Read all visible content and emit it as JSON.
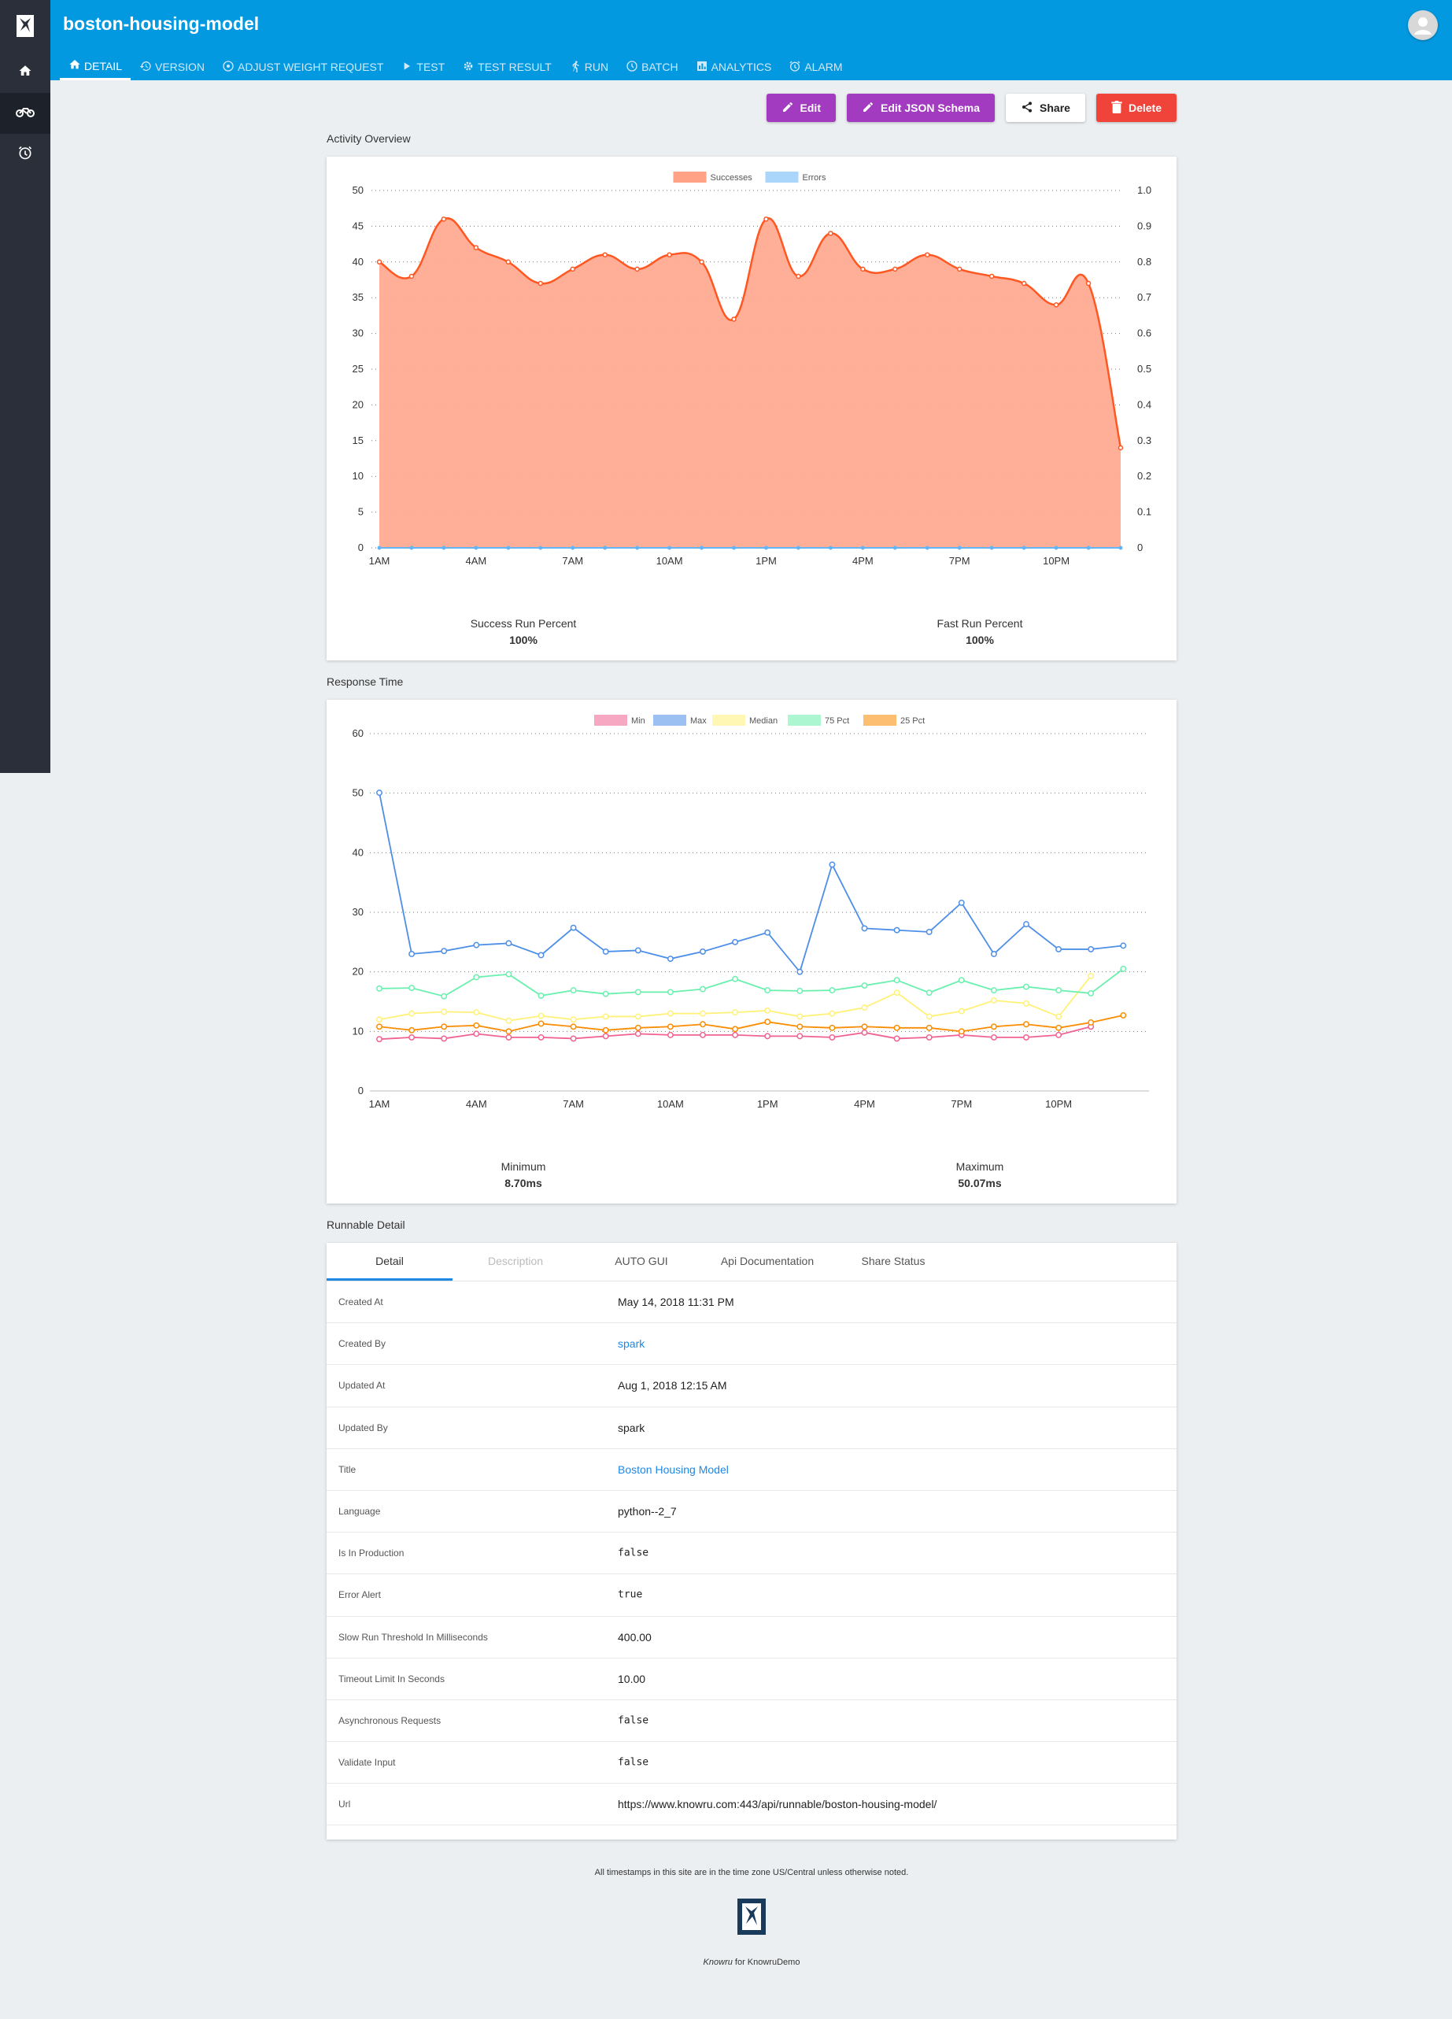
{
  "app": {
    "title": "boston-housing-model"
  },
  "sidebar": {
    "items": [
      {
        "icon": "home-icon"
      },
      {
        "icon": "motorcycle-icon"
      },
      {
        "icon": "alarm-icon"
      }
    ]
  },
  "tabs": [
    {
      "label": "DETAIL",
      "icon": "home-icon",
      "active": true
    },
    {
      "label": "VERSION",
      "icon": "history-icon"
    },
    {
      "label": "ADJUST WEIGHT REQUEST",
      "icon": "target-icon"
    },
    {
      "label": "TEST",
      "icon": "play-icon"
    },
    {
      "label": "TEST RESULT",
      "icon": "gear-icon"
    },
    {
      "label": "RUN",
      "icon": "run-icon"
    },
    {
      "label": "BATCH",
      "icon": "clock-icon"
    },
    {
      "label": "ANALYTICS",
      "icon": "bar-chart-icon"
    },
    {
      "label": "ALARM",
      "icon": "alarm-icon"
    }
  ],
  "actions": {
    "edit": "Edit",
    "edit_schema": "Edit JSON Schema",
    "share": "Share",
    "delete": "Delete"
  },
  "activity": {
    "title": "Activity Overview",
    "success_label": "Success Run Percent",
    "success_value": "100%",
    "fast_label": "Fast Run Percent",
    "fast_value": "100%"
  },
  "response": {
    "title": "Response Time",
    "min_label": "Minimum",
    "min_value": "8.70ms",
    "max_label": "Maximum",
    "max_value": "50.07ms"
  },
  "chart_data": [
    {
      "type": "area",
      "x": [
        "1AM",
        "2AM",
        "3AM",
        "4AM",
        "5AM",
        "6AM",
        "7AM",
        "8AM",
        "9AM",
        "10AM",
        "11AM",
        "12PM",
        "1PM",
        "2PM",
        "3PM",
        "4PM",
        "5PM",
        "6PM",
        "7PM",
        "8PM",
        "9PM",
        "10PM",
        "11PM",
        "12AM"
      ],
      "xticks": [
        "1AM",
        "4AM",
        "7AM",
        "10AM",
        "1PM",
        "4PM",
        "7PM",
        "10PM"
      ],
      "series": [
        {
          "name": "Successes",
          "axis": "left",
          "color": "#ff5722",
          "values": [
            40,
            38,
            46,
            42,
            40,
            37,
            39,
            41,
            39,
            41,
            40,
            32,
            46,
            38,
            44,
            39,
            39,
            41,
            39,
            38,
            37,
            34,
            37,
            14
          ]
        },
        {
          "name": "Errors",
          "axis": "right",
          "color": "#64b5f6",
          "values": [
            0,
            0,
            0,
            0,
            0,
            0,
            0,
            0,
            0,
            0,
            0,
            0,
            0,
            0,
            0,
            0,
            0,
            0,
            0,
            0,
            0,
            0,
            0,
            0
          ]
        }
      ],
      "yticks_left": [
        "0",
        "5",
        "10",
        "15",
        "20",
        "25",
        "30",
        "35",
        "40",
        "45",
        "50"
      ],
      "yticks_right": [
        "0",
        "0.1",
        "0.2",
        "0.3",
        "0.4",
        "0.5",
        "0.6",
        "0.7",
        "0.8",
        "0.9",
        "1.0"
      ],
      "ylim": [
        0,
        50
      ],
      "y2lim": [
        0,
        1
      ],
      "legend": "top"
    },
    {
      "type": "line",
      "x": [
        "1AM",
        "2AM",
        "3AM",
        "4AM",
        "5AM",
        "6AM",
        "7AM",
        "8AM",
        "9AM",
        "10AM",
        "11AM",
        "12PM",
        "1PM",
        "2PM",
        "3PM",
        "4PM",
        "5PM",
        "6PM",
        "7PM",
        "8PM",
        "9PM",
        "10PM",
        "11PM",
        "12AM"
      ],
      "xticks": [
        "1AM",
        "4AM",
        "7AM",
        "10AM",
        "1PM",
        "4PM",
        "7PM",
        "10PM"
      ],
      "series": [
        {
          "name": "Min",
          "color": "#f06292",
          "values": [
            8.7,
            9,
            8.8,
            9.6,
            9,
            9,
            8.8,
            9.2,
            9.6,
            9.4,
            9.4,
            9.4,
            9.2,
            9.2,
            9,
            9.8,
            8.8,
            9,
            9.4,
            9,
            9,
            9.4,
            10.8,
            null
          ]
        },
        {
          "name": "Max",
          "color": "#4d8ee8",
          "values": [
            50.07,
            23,
            23.5,
            24.5,
            24.8,
            22.8,
            27.4,
            23.4,
            23.6,
            22.2,
            23.4,
            25,
            26.6,
            20,
            38,
            27.3,
            27,
            26.7,
            31.6,
            23,
            28,
            23.8,
            23.8,
            24.4
          ]
        },
        {
          "name": "Median",
          "color": "#fff176",
          "values": [
            12,
            13,
            13.3,
            13.2,
            11.8,
            12.6,
            12,
            12.5,
            12.5,
            13,
            13,
            13.2,
            13.5,
            12.5,
            13,
            14,
            16.5,
            12.5,
            13.4,
            15.2,
            14.7,
            12.5,
            19.3,
            null
          ]
        },
        {
          "name": "75 Pct",
          "color": "#69f0ae",
          "values": [
            17.2,
            17.3,
            15.9,
            19.1,
            19.6,
            16,
            16.9,
            16.3,
            16.6,
            16.6,
            17.1,
            18.8,
            16.9,
            16.8,
            16.9,
            17.7,
            18.6,
            16.5,
            18.6,
            16.9,
            17.5,
            16.9,
            16.4,
            20.5
          ]
        },
        {
          "name": "25 Pct",
          "color": "#fb8c00",
          "values": [
            10.8,
            10.2,
            10.8,
            11,
            10,
            11.3,
            10.8,
            10.2,
            10.6,
            10.8,
            11.2,
            10.4,
            11.6,
            10.8,
            10.6,
            10.8,
            10.6,
            10.6,
            10,
            10.8,
            11.2,
            10.6,
            11.5,
            12.7
          ]
        }
      ],
      "yticks": [
        "0",
        "10",
        "20",
        "30",
        "40",
        "50",
        "60"
      ],
      "ylim": [
        0,
        60
      ],
      "legend": "top"
    }
  ],
  "detail": {
    "title": "Runnable Detail",
    "tabs": [
      "Detail",
      "Description",
      "AUTO GUI",
      "Api Documentation",
      "Share Status"
    ],
    "rows": [
      {
        "key": "Created At",
        "value": "May 14, 2018 11:31 PM",
        "style": "plain"
      },
      {
        "key": "Created By",
        "value": "spark",
        "style": "link"
      },
      {
        "key": "Updated At",
        "value": "Aug 1, 2018 12:15 AM",
        "style": "plain"
      },
      {
        "key": "Updated By",
        "value": "spark",
        "style": "plain"
      },
      {
        "key": "Title",
        "value": "Boston Housing Model",
        "style": "link"
      },
      {
        "key": "Language",
        "value": "python--2_7",
        "style": "plain"
      },
      {
        "key": "Is In Production",
        "value": "false",
        "style": "mono"
      },
      {
        "key": "Error Alert",
        "value": "true",
        "style": "mono"
      },
      {
        "key": "Slow Run Threshold In Milliseconds",
        "value": "400.00",
        "style": "plain"
      },
      {
        "key": "Timeout Limit In Seconds",
        "value": "10.00",
        "style": "plain"
      },
      {
        "key": "Asynchronous Requests",
        "value": "false",
        "style": "mono"
      },
      {
        "key": "Validate Input",
        "value": "false",
        "style": "mono"
      },
      {
        "key": "Url",
        "value": "https://www.knowru.com:443/api/runnable/boston-housing-model/",
        "style": "plain"
      }
    ]
  },
  "footer": {
    "note": "All timestamps in this site are in the time zone US/Central unless otherwise noted.",
    "brand": "Knowru",
    "brand_suffix": " for KnowruDemo"
  }
}
